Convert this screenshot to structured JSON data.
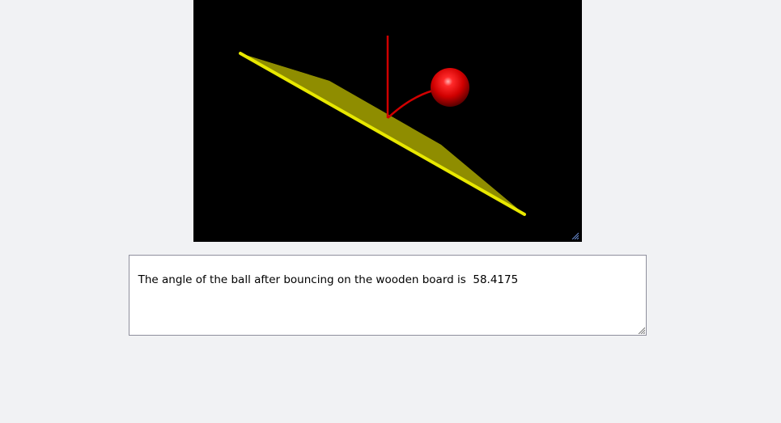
{
  "scene": {
    "background_color": "#000000",
    "board_color": "#9c9a00",
    "board_edge_color": "#e8e800",
    "ball_color": "#e00000",
    "trail_color": "#cc0000"
  },
  "output": {
    "text": "The angle of the ball after bouncing on the wooden board is  58.4175"
  }
}
